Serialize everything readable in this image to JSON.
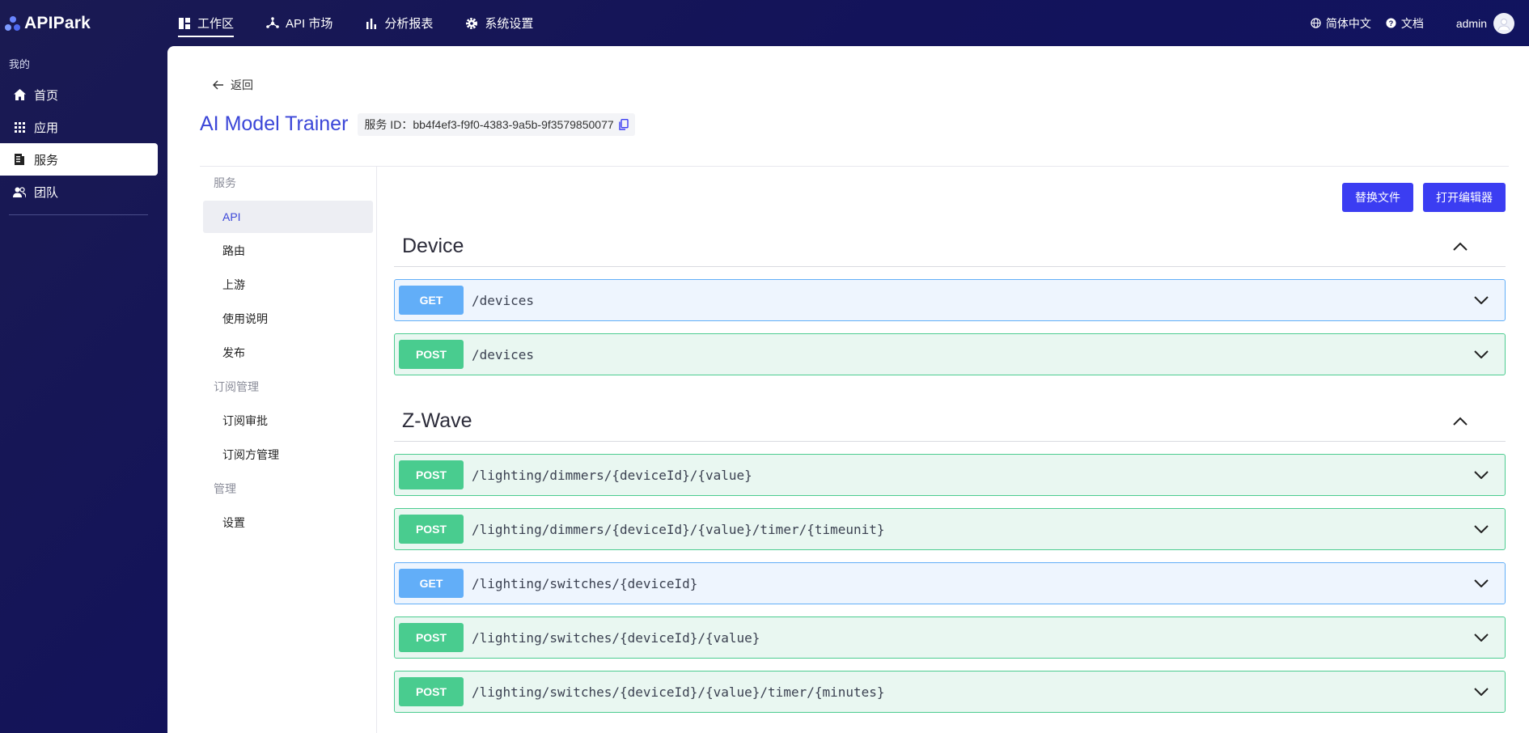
{
  "app": {
    "name": "APIPark"
  },
  "topnav": [
    {
      "label": "工作区",
      "icon": "dashboard-icon",
      "active": true
    },
    {
      "label": "API 市场",
      "icon": "hub-icon",
      "active": false
    },
    {
      "label": "分析报表",
      "icon": "bar-chart-icon",
      "active": false
    },
    {
      "label": "系统设置",
      "icon": "gear-icon",
      "active": false
    }
  ],
  "topright": {
    "language": "简体中文",
    "docs": "文档",
    "user": "admin"
  },
  "sidebar": {
    "group": "我的",
    "items": [
      {
        "label": "首页",
        "icon": "home-icon"
      },
      {
        "label": "应用",
        "icon": "grid-icon"
      },
      {
        "label": "服务",
        "icon": "service-icon",
        "active": true
      },
      {
        "label": "团队",
        "icon": "team-icon"
      }
    ]
  },
  "page": {
    "back": "返回",
    "service_name": "AI Model Trainer",
    "service_id_label": "服务 ID：",
    "service_id": "bb4f4ef3-f9f0-4383-9a5b-9f3579850077"
  },
  "subnav": {
    "group_service": "服务",
    "items_service": [
      "API",
      "路由",
      "上游",
      "使用说明",
      "发布"
    ],
    "group_subscription": "订阅管理",
    "items_subscription": [
      "订阅审批",
      "订阅方管理"
    ],
    "group_manage": "管理",
    "items_manage": [
      "设置"
    ]
  },
  "actions": {
    "replace_file": "替换文件",
    "open_editor": "打开编辑器"
  },
  "sections": [
    {
      "title": "Device",
      "ops": [
        {
          "method": "GET",
          "path": "/devices"
        },
        {
          "method": "POST",
          "path": "/devices"
        }
      ]
    },
    {
      "title": "Z-Wave",
      "ops": [
        {
          "method": "POST",
          "path": "/lighting/dimmers/{deviceId}/{value}"
        },
        {
          "method": "POST",
          "path": "/lighting/dimmers/{deviceId}/{value}/timer/{timeunit}"
        },
        {
          "method": "GET",
          "path": "/lighting/switches/{deviceId}"
        },
        {
          "method": "POST",
          "path": "/lighting/switches/{deviceId}/{value}"
        },
        {
          "method": "POST",
          "path": "/lighting/switches/{deviceId}/{value}/timer/{minutes}"
        }
      ]
    }
  ],
  "colors": {
    "accent": "#3b3df2",
    "title": "#3b46d8",
    "get": "#62aef8",
    "post": "#49cc8f"
  }
}
